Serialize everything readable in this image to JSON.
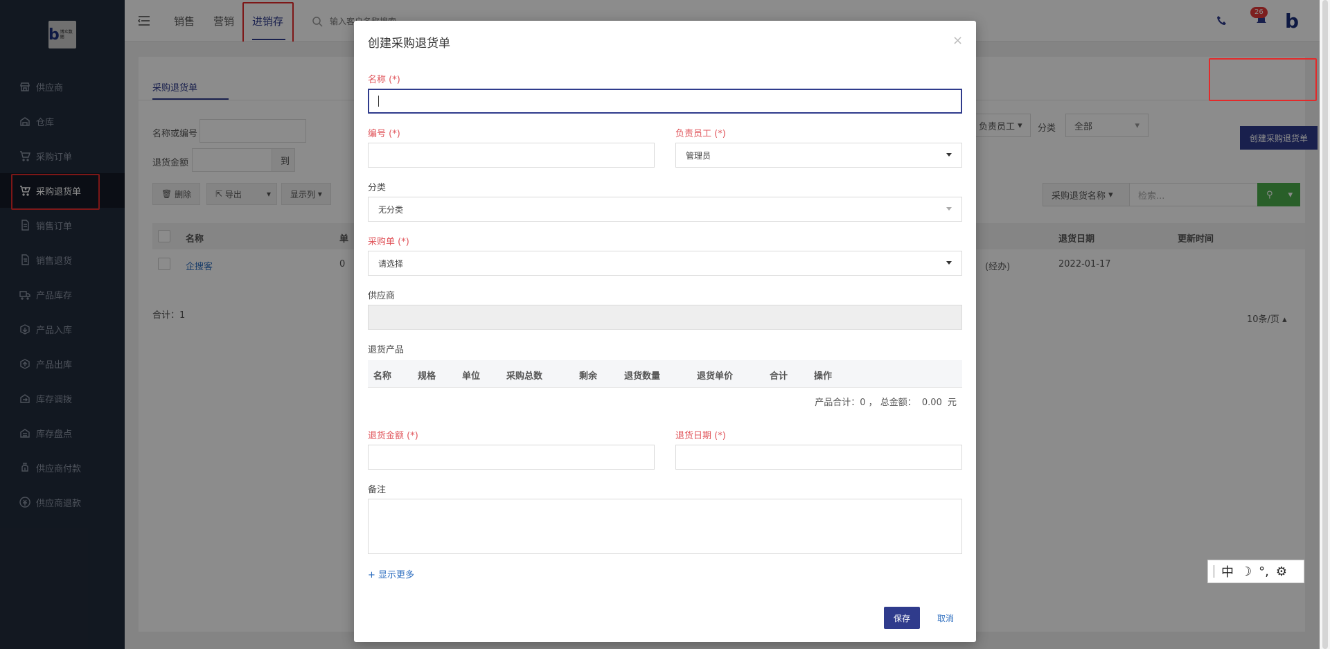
{
  "sidebar": {
    "logo_text": "博众数据",
    "items": [
      {
        "label": "供应商",
        "icon": "store-icon"
      },
      {
        "label": "仓库",
        "icon": "warehouse-icon"
      },
      {
        "label": "采购订单",
        "icon": "cart-icon"
      },
      {
        "label": "采购退货单",
        "icon": "cart-return-icon"
      },
      {
        "label": "销售订单",
        "icon": "document-icon"
      },
      {
        "label": "销售退货",
        "icon": "document-return-icon"
      },
      {
        "label": "产品库存",
        "icon": "truck-icon"
      },
      {
        "label": "产品入库",
        "icon": "box-in-icon"
      },
      {
        "label": "产品出库",
        "icon": "box-out-icon"
      },
      {
        "label": "库存调拨",
        "icon": "transfer-icon"
      },
      {
        "label": "库存盘点",
        "icon": "inventory-icon"
      },
      {
        "label": "供应商付款",
        "icon": "money-bag-icon"
      },
      {
        "label": "供应商退款",
        "icon": "refund-icon"
      }
    ],
    "active_index": 3
  },
  "topbar": {
    "tabs": [
      "销售",
      "营销",
      "进销存"
    ],
    "active_tab": "进销存",
    "search_placeholder": "输入客户名称搜索",
    "notification_count": "26"
  },
  "page": {
    "tab": "采购退货单",
    "create_button": "创建采购退货单",
    "filters": {
      "name_or_code_label": "名称或编号",
      "amount_label": "退货金额",
      "to_label": "到",
      "employee_label": "负责员工",
      "category_label": "分类",
      "category_value": "全部"
    },
    "toolbar": {
      "delete": "删除",
      "export": "导出",
      "columns": "显示列"
    },
    "search_field": "采购退货名称",
    "search_placeholder": "检索...",
    "columns": [
      "名称",
      "单",
      "退货日期",
      "更新时间"
    ],
    "rows": [
      {
        "name": "企搜客",
        "code": "0",
        "employee": "(经办)",
        "date": "2022-01-17"
      }
    ],
    "total": "合计：1",
    "page_size": "10条/页"
  },
  "modal": {
    "title": "创建采购退货单",
    "close": "×",
    "fields": {
      "name_label": "名称 (*)",
      "code_label": "编号 (*)",
      "employee_label": "负责员工 (*)",
      "employee_value": "管理员",
      "category_label": "分类",
      "category_value": "无分类",
      "purchase_order_label": "采购单 (*)",
      "purchase_order_value": "请选择",
      "supplier_label": "供应商",
      "return_products_label": "退货产品",
      "amount_label": "退货金额 (*)",
      "date_label": "退货日期 (*)",
      "remark_label": "备注"
    },
    "product_columns": [
      "名称",
      "规格",
      "单位",
      "采购总数",
      "剩余",
      "退货数量",
      "退货单价",
      "合计",
      "操作"
    ],
    "summary": {
      "product_total": "产品合计：0 ，",
      "total_amount_label": "总金额：",
      "total_amount": "0.00",
      "unit": "元"
    },
    "show_more": "+ 显示更多",
    "save": "保存",
    "cancel": "取消"
  },
  "ime": {
    "mode": "中",
    "moon": "☽",
    "punct": "°,",
    "settings": "⚙"
  },
  "colors": {
    "primary": "#2f3b8c",
    "required": "#e0555b",
    "sidebar": "#222c3c",
    "highlight": "#e32a2a"
  }
}
